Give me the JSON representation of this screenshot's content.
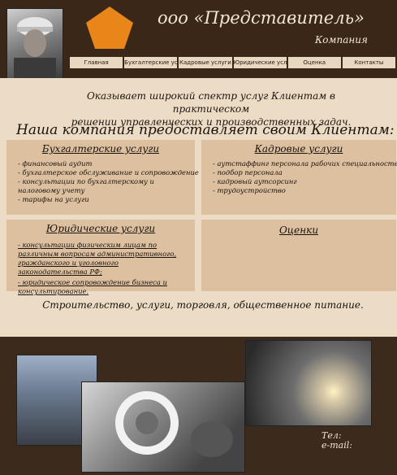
{
  "header": {
    "company_name": "ооо «Представитель»",
    "company_sub": "Компания",
    "logo_color": "#e8861a"
  },
  "nav": {
    "items": [
      {
        "label": "Главная"
      },
      {
        "label": "Бухгалтерские услуги"
      },
      {
        "label": "Кадровые услуги"
      },
      {
        "label": "Юридические услуги"
      },
      {
        "label": "Оценка"
      },
      {
        "label": "Контакты"
      }
    ]
  },
  "main": {
    "intro_line1": "Оказывает широкий спектр услуг Клиентам в практическом",
    "intro_line2": "решении управленческих и производственных задач.",
    "headline": "Наша компания предоставляет своим Клиентам:",
    "accounting": {
      "title": "Бухгалтерские услуги",
      "items": [
        "- финансовый аудит",
        "- бухгалтерское обслуживание и сопровождение",
        "- консультации по бухгалтерскому и налоговому учету",
        "- тарифы на услуги"
      ]
    },
    "hr": {
      "title": "Кадровые услуги",
      "items": [
        "- аутстаффинг персонала рабочих специальностей",
        "- подбор персонала",
        "- кадровый аутсорсинг",
        "- трудоустройство"
      ]
    },
    "legal": {
      "title": "Юридические услуги",
      "para1": "- консультации физическим лицам по различным вопросам административного, гражданского и уголовного законодательства РФ;",
      "para2": "- юридическое сопровождение бизнеса и консультирование."
    },
    "valuation": {
      "title": "Оценки"
    },
    "tagline": "Строительство, услуги, торговля, общественное питание."
  },
  "footer": {
    "tel_label": "Тел:",
    "email_label": "e-mail:"
  }
}
